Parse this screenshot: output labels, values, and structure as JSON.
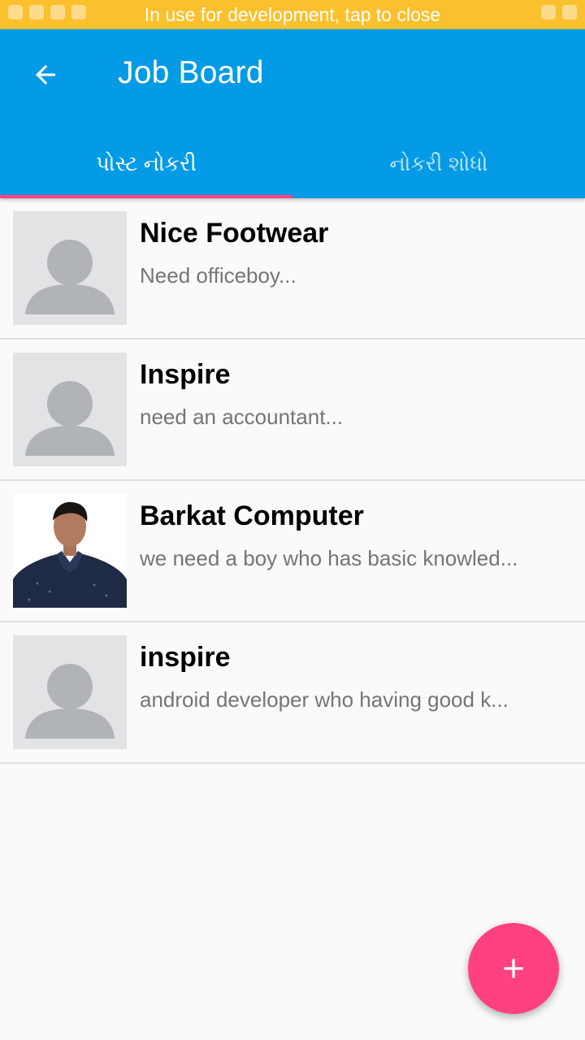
{
  "status_bar": {
    "text": "In use for development, tap to close",
    "color": "#fbc02d"
  },
  "app_bar": {
    "title": "Job Board",
    "back_icon": "arrow-left-icon",
    "color": "#039be5"
  },
  "tabs": [
    {
      "label": "પોસ્ટ નોકરી",
      "active": true
    },
    {
      "label": "નોકરી શોધો",
      "active": false
    }
  ],
  "accent_color": "#ff4081",
  "jobs": [
    {
      "title": "Nice Footwear",
      "description": "Need officeboy...",
      "avatar": "placeholder-person-icon"
    },
    {
      "title": "Inspire",
      "description": "need an accountant...",
      "avatar": "placeholder-person-icon"
    },
    {
      "title": "Barkat Computer",
      "description": "we need a boy who has basic knowled...",
      "avatar": "profile-photo"
    },
    {
      "title": "inspire",
      "description": "android developer who having good k...",
      "avatar": "placeholder-person-icon"
    }
  ],
  "fab": {
    "icon": "plus-icon"
  }
}
